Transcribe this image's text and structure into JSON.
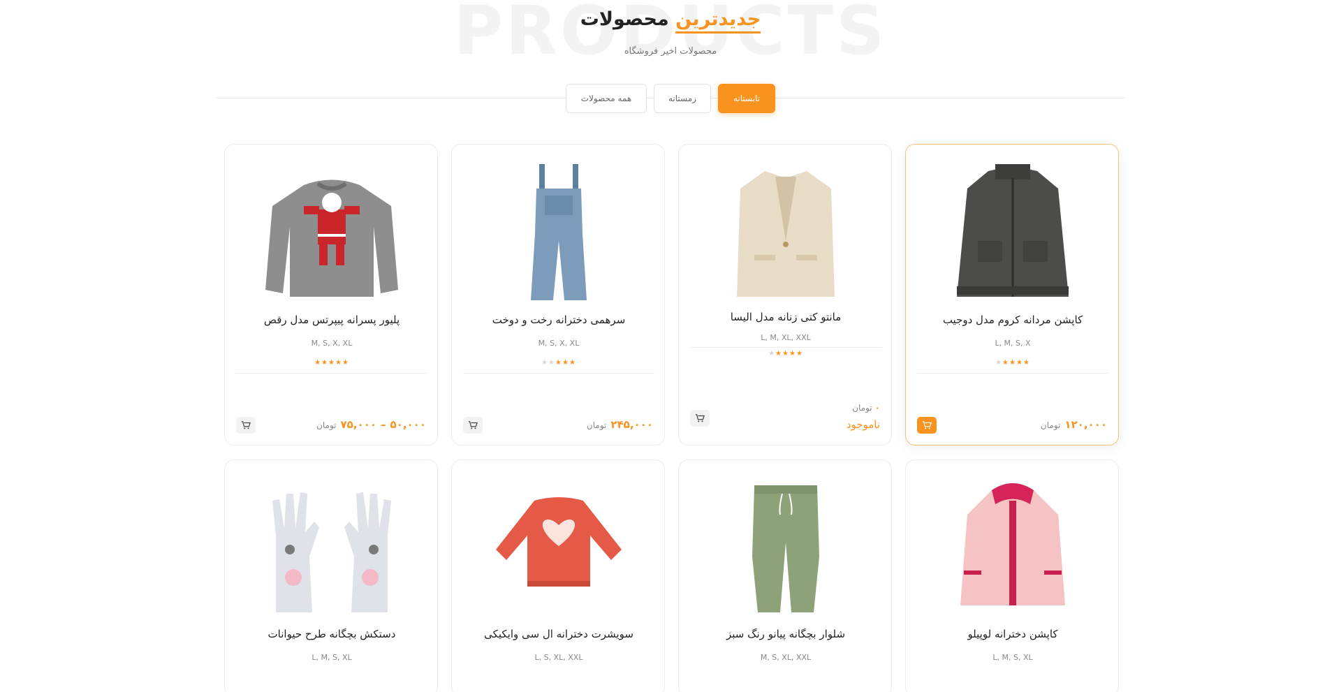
{
  "section": {
    "watermark": "PRODUCTS",
    "title_accent": "جدیدترین",
    "title_rest": "محصولات",
    "subtitle": "محصولات اخیر فروشگاه"
  },
  "tabs": {
    "all": "همه محصولات",
    "winter": "زمستانه",
    "summer": "تابستانه",
    "active": "تابستانه"
  },
  "colors": {
    "accent": "#f7931e"
  },
  "currency": "تومان",
  "products": [
    {
      "name": "کاپشن مردانه کروم مدل دوجیب",
      "sizes": "L, M, S, X",
      "rating": 4.5,
      "price": "۱۲۰,۰۰۰",
      "icon": "jacket-icon"
    },
    {
      "name": "مانتو کتی زنانه مدل الیسا",
      "sizes": "L, M, XL, XXL",
      "rating": 4,
      "price_zero": "۰",
      "status": "ناموجود",
      "icon": "coat-icon"
    },
    {
      "name": "سرهمی دخترانه رخت و دوخت",
      "sizes": "M, S, X, XL",
      "rating": 3,
      "price": "۲۴۵,۰۰۰",
      "icon": "overalls-icon"
    },
    {
      "name": "پلیور پسرانه پیپرتس مدل رقص",
      "sizes": "M, S, X, XL",
      "rating": 5,
      "price_min": "۵۰,۰۰۰",
      "price_max": "۷۵,۰۰۰",
      "icon": "sweater-icon"
    },
    {
      "name": "کاپشن دخترانه لوپیلو",
      "sizes": "L, M, S, XL",
      "icon": "pink-jacket-icon"
    },
    {
      "name": "شلوار بچگانه پیانو رنگ سبز",
      "sizes": "M, S, XL, XXL",
      "icon": "pants-icon"
    },
    {
      "name": "سویشرت دخترانه ال سی وایکیکی",
      "sizes": "L, S, XL, XXL",
      "icon": "sweatshirt-icon"
    },
    {
      "name": "دستکش بچگانه طرح حیوانات",
      "sizes": "L, M, S, XL",
      "icon": "gloves-icon"
    }
  ]
}
